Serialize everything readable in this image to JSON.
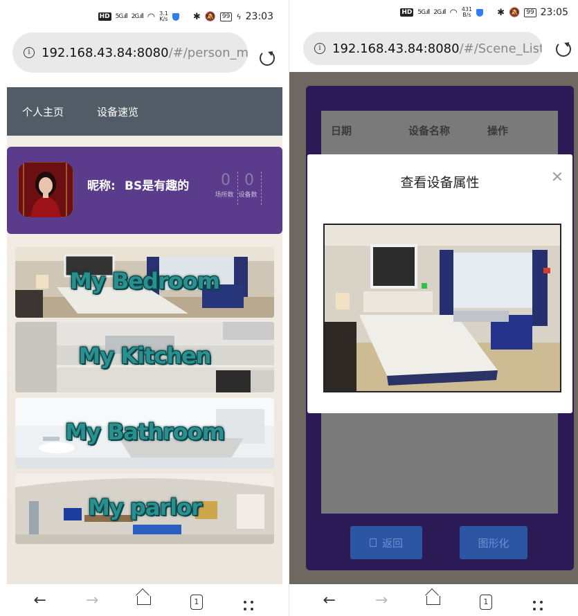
{
  "left": {
    "status": {
      "hd": "HD",
      "sig1": "5G.ıll",
      "sig2": "2G.ıll",
      "speed_num": "3.1",
      "speed_unit": "K/s",
      "battery": "99",
      "time": "23:03"
    },
    "url": {
      "host": "192.168.43.84:8080",
      "path": "/#/person_mol"
    },
    "nav": {
      "home": "个人主页",
      "overview": "设备速览"
    },
    "profile": {
      "nickname_label": "昵称:",
      "nickname": "BS是有趣的",
      "places_count": "0",
      "places_label": "场所数",
      "devices_count": "0",
      "devices_label": "设备数"
    },
    "rooms": [
      {
        "label": "My Bedroom"
      },
      {
        "label": "My Kitchen"
      },
      {
        "label": "My Bathroom"
      },
      {
        "label": "My parlor"
      }
    ],
    "bottom": {
      "tab_count": "1"
    }
  },
  "right": {
    "status": {
      "hd": "HD",
      "sig1": "5G.ıll",
      "sig2": "2G.ıll",
      "speed_num": "431",
      "speed_unit": "B/s",
      "battery": "99",
      "time": "23:05"
    },
    "url": {
      "host": "192.168.43.84:8080",
      "path": "/#/Scene_List/"
    },
    "table": {
      "col_date": "日期",
      "col_name": "设备名称",
      "col_action": "操作"
    },
    "modal": {
      "title": "查看设备属性"
    },
    "buttons": {
      "back": "返回",
      "graph": "图形化"
    },
    "bottom": {
      "tab_count": "1"
    }
  }
}
